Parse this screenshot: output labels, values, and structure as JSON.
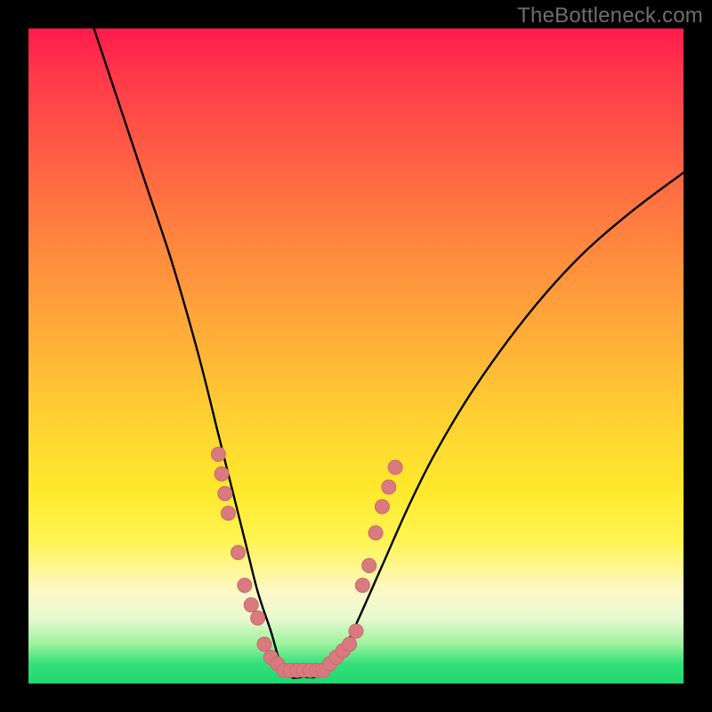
{
  "watermark": "TheBottleneck.com",
  "colors": {
    "frame": "#000000",
    "curve": "#000000",
    "markers_fill": "#d97a7f",
    "markers_stroke": "#c96a6f",
    "gradient_top": "#ff1a4d",
    "gradient_bottom": "#1fd870"
  },
  "chart_data": {
    "type": "line",
    "title": "",
    "xlabel": "",
    "ylabel": "",
    "xlim": [
      0,
      100
    ],
    "ylim": [
      0,
      100
    ],
    "grid": false,
    "legend": false,
    "series": [
      {
        "name": "bottleneck-curve",
        "note": "V-shaped curve; y is approximate bottleneck % (0 = best, 100 = worst). Values estimated from pixel positions.",
        "x": [
          10,
          14,
          18,
          22,
          26,
          29,
          31,
          33,
          35,
          37,
          38.5,
          40,
          42,
          44,
          46,
          48,
          50,
          54,
          58,
          62,
          68,
          76,
          84,
          92,
          100
        ],
        "y": [
          100,
          88,
          76,
          64,
          50,
          38,
          30,
          22,
          14,
          8,
          3,
          1,
          1,
          1,
          2,
          5,
          9,
          18,
          27,
          35,
          45,
          56,
          65,
          72,
          78
        ]
      }
    ],
    "markers": {
      "name": "highlighted-points",
      "note": "Pink scatter markers clustered near the bottom of the V on both arms.",
      "points": [
        {
          "x": 29.0,
          "y": 35
        },
        {
          "x": 29.5,
          "y": 32
        },
        {
          "x": 30.0,
          "y": 29
        },
        {
          "x": 30.5,
          "y": 26
        },
        {
          "x": 32.0,
          "y": 20
        },
        {
          "x": 33.0,
          "y": 15
        },
        {
          "x": 34.0,
          "y": 12
        },
        {
          "x": 35.0,
          "y": 10
        },
        {
          "x": 36.0,
          "y": 6
        },
        {
          "x": 37.0,
          "y": 4
        },
        {
          "x": 38.0,
          "y": 3
        },
        {
          "x": 39.0,
          "y": 2
        },
        {
          "x": 40.0,
          "y": 2
        },
        {
          "x": 41.0,
          "y": 2
        },
        {
          "x": 42.0,
          "y": 2
        },
        {
          "x": 43.0,
          "y": 2
        },
        {
          "x": 44.0,
          "y": 2
        },
        {
          "x": 45.0,
          "y": 2
        },
        {
          "x": 46.0,
          "y": 3
        },
        {
          "x": 47.0,
          "y": 4
        },
        {
          "x": 48.0,
          "y": 5
        },
        {
          "x": 49.0,
          "y": 6
        },
        {
          "x": 50.0,
          "y": 8
        },
        {
          "x": 51.0,
          "y": 15
        },
        {
          "x": 52.0,
          "y": 18
        },
        {
          "x": 53.0,
          "y": 23
        },
        {
          "x": 54.0,
          "y": 27
        },
        {
          "x": 55.0,
          "y": 30
        },
        {
          "x": 56.0,
          "y": 33
        }
      ]
    }
  }
}
